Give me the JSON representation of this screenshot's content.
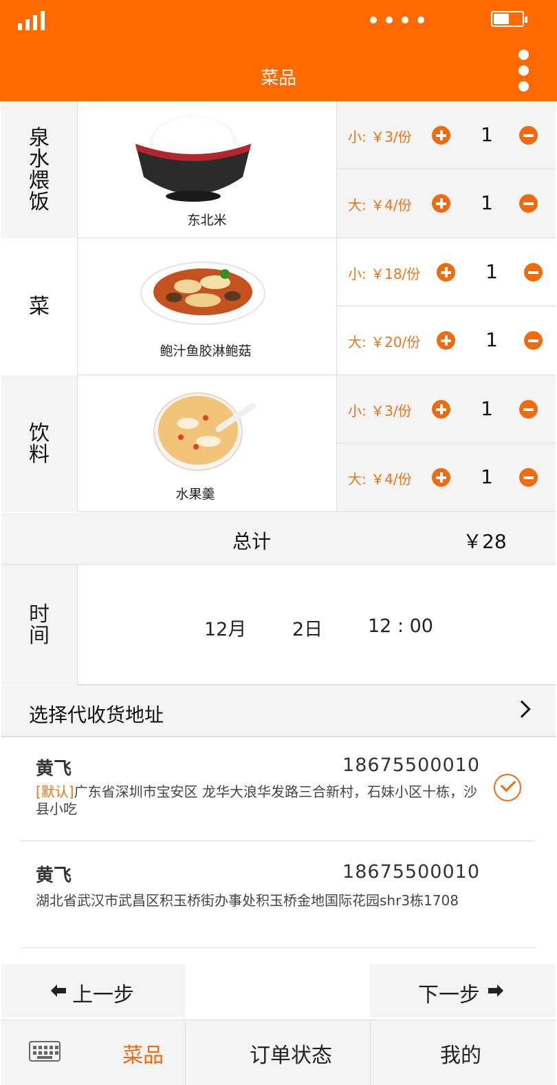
{
  "status_bar": {
    "signal_icon": "signal-icon",
    "battery_icon": "battery-icon"
  },
  "header": {
    "title": "菜品"
  },
  "menu": [
    {
      "category": "泉水煨饭",
      "dish": "东北米",
      "image_icon": "rice-bowl-image",
      "options": [
        {
          "size": "小:",
          "price": "￥3/份",
          "qty": "1"
        },
        {
          "size": "大:",
          "price": "￥4/份",
          "qty": "1"
        }
      ]
    },
    {
      "category": "菜",
      "dish": "鲍汁鱼胶淋鲍菇",
      "image_icon": "mushroom-dish-image",
      "options": [
        {
          "size": "小:",
          "price": "￥18/份",
          "qty": "1"
        },
        {
          "size": "大:",
          "price": "￥20/份",
          "qty": "1"
        }
      ]
    },
    {
      "category": "饮料",
      "dish": "水果羹",
      "image_icon": "fruit-soup-image",
      "options": [
        {
          "size": "小:",
          "price": "￥3/份",
          "qty": "1"
        },
        {
          "size": "大:",
          "price": "￥4/份",
          "qty": "1"
        }
      ]
    }
  ],
  "total": {
    "label": "总计",
    "value": "￥28"
  },
  "time": {
    "label": "时间",
    "month": "12月",
    "day": "2日",
    "clock": "12 : 00"
  },
  "address_section": {
    "label": "选择代收货地址"
  },
  "addresses": [
    {
      "name": "黄飞",
      "phone": "18675500010",
      "tag": "[默认]",
      "text": "广东省深圳市宝安区 龙华大浪华发路三合新村，石妹小区十栋，沙县小吃",
      "selected": true
    },
    {
      "name": "黄飞",
      "phone": "18675500010",
      "tag": "",
      "text": "湖北省武汉市武昌区积玉桥街办事处积玉桥金地国际花园shr3栋1708",
      "selected": false
    }
  ],
  "steps": {
    "prev": "上一步",
    "next": "下一步"
  },
  "tabs": [
    {
      "label": "菜品",
      "active": true
    },
    {
      "label": "订单状态",
      "active": false
    },
    {
      "label": "我的",
      "active": false
    }
  ],
  "colors": {
    "accent": "#ff6a00",
    "button": "#ee6b10",
    "price": "#e8751a",
    "panel": "#f4f4f4"
  }
}
